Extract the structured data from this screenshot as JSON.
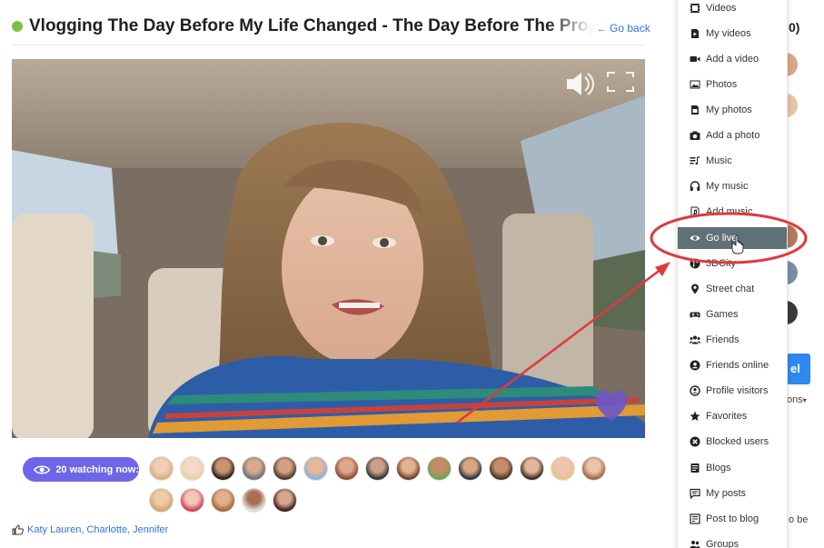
{
  "header": {
    "title": "Vlogging The Day Before My Life Changed - The Day Before The Prop",
    "go_back": "Go back"
  },
  "watching": {
    "label": "20 watching now:",
    "viewer_count": 20,
    "avatars_row1": 15,
    "avatars_row2": 5
  },
  "likes": {
    "names": "Katy Lauren, Charlotte, Jennifer"
  },
  "right_panel": {
    "count_fragment": "0)",
    "button_fragment": "el",
    "options_fragment": "ons",
    "text_fragment": "o be"
  },
  "menu": {
    "items": [
      {
        "label": "Videos",
        "icon": "film-icon"
      },
      {
        "label": "My videos",
        "icon": "file-video-icon"
      },
      {
        "label": "Add a video",
        "icon": "video-camera-icon"
      },
      {
        "label": "Photos",
        "icon": "image-icon"
      },
      {
        "label": "My photos",
        "icon": "file-image-icon"
      },
      {
        "label": "Add a photo",
        "icon": "camera-icon"
      },
      {
        "label": "Music",
        "icon": "music-list-icon"
      },
      {
        "label": "My music",
        "icon": "headphones-icon"
      },
      {
        "label": "Add music",
        "icon": "music-file-icon"
      },
      {
        "label": "Go live",
        "icon": "eye-icon",
        "active": true
      },
      {
        "label": "3DCity",
        "icon": "globe-icon"
      },
      {
        "label": "Street chat",
        "icon": "map-marker-icon"
      },
      {
        "label": "Games",
        "icon": "gamepad-icon"
      },
      {
        "label": "Friends",
        "icon": "users-icon"
      },
      {
        "label": "Friends online",
        "icon": "user-circle-icon"
      },
      {
        "label": "Profile visitors",
        "icon": "visitor-icon"
      },
      {
        "label": "Favorites",
        "icon": "star-icon"
      },
      {
        "label": "Blocked users",
        "icon": "block-icon"
      },
      {
        "label": "Blogs",
        "icon": "blogs-icon"
      },
      {
        "label": "My posts",
        "icon": "comment-icon"
      },
      {
        "label": "Post to blog",
        "icon": "post-icon"
      },
      {
        "label": "Groups",
        "icon": "groups-icon"
      }
    ]
  },
  "colors": {
    "accent": "#6c66e8",
    "link": "#2f73d9",
    "live_dot": "#7cc242",
    "menu_active": "#5f7076",
    "annotation": "#e0393e"
  }
}
